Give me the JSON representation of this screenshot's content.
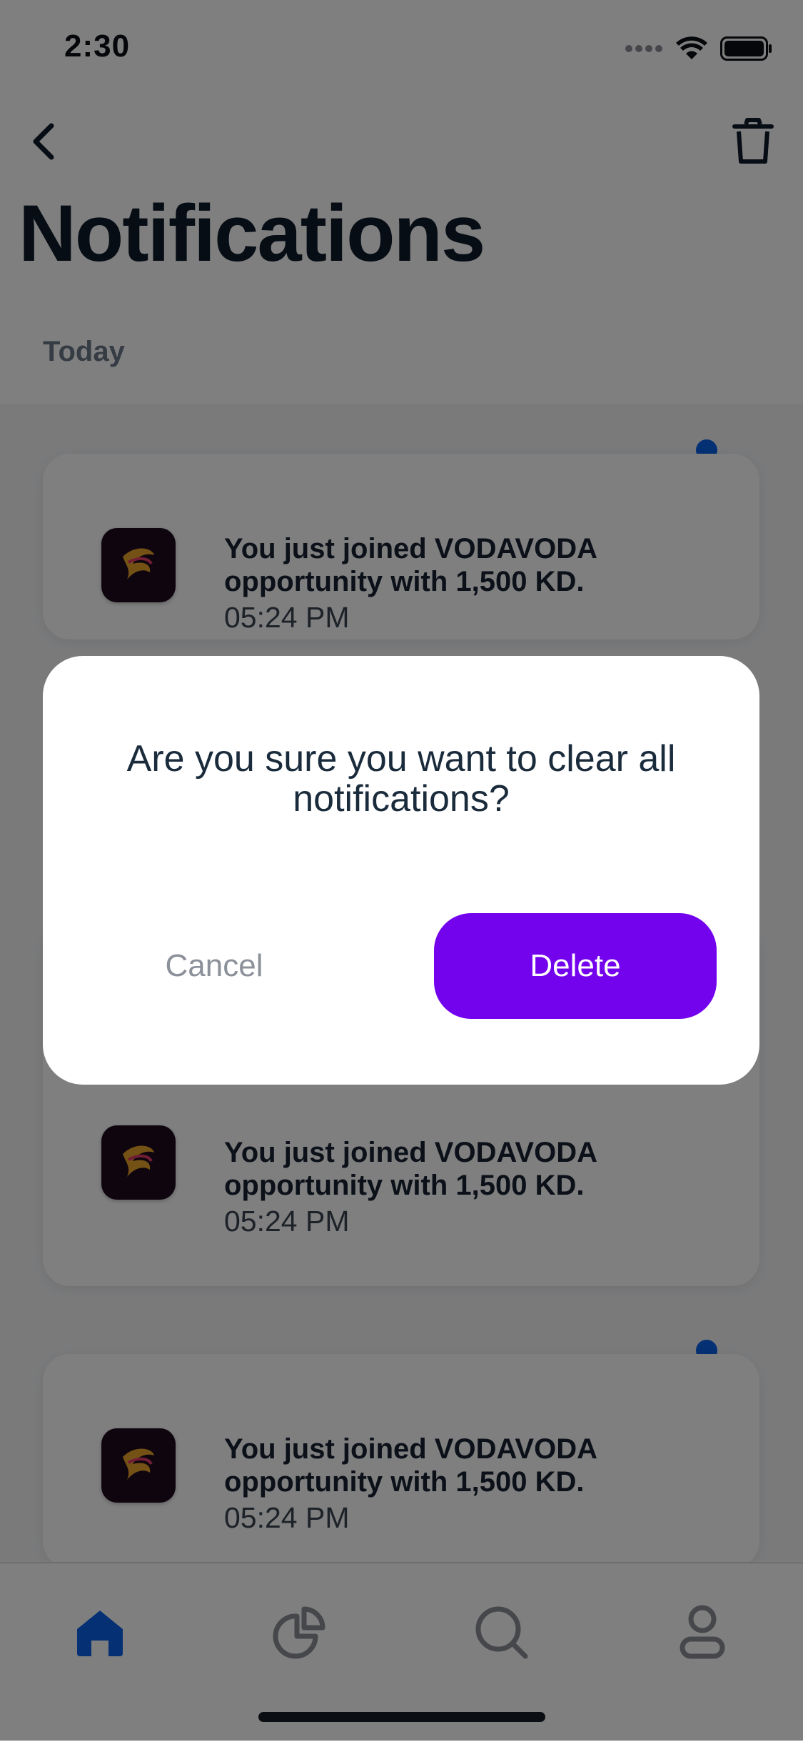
{
  "status_bar": {
    "time": "2:30"
  },
  "header": {
    "title": "Notifications"
  },
  "section": {
    "label": "Today"
  },
  "notifications": [
    {
      "message": "You just joined VODAVODA opportunity with 1,500 KD.",
      "time": "05:24 PM",
      "unread": true
    },
    {
      "message": "You just joined VODAVODA opportunity with 1,500 KD.",
      "time": "05:24 PM",
      "unread": false
    },
    {
      "message": "You just joined VODAVODA opportunity with 1,500 KD.",
      "time": "05:24 PM",
      "unread": true
    }
  ],
  "dialog": {
    "message": "Are you sure you want to clear all notifications?",
    "cancel_label": "Cancel",
    "delete_label": "Delete"
  },
  "bottom_nav": {
    "items": [
      {
        "icon": "home-icon",
        "active": true
      },
      {
        "icon": "portfolio-icon",
        "active": false
      },
      {
        "icon": "search-icon",
        "active": false
      },
      {
        "icon": "profile-icon",
        "active": false
      }
    ]
  },
  "colors": {
    "accent": "#7403ed",
    "unread_dot": "#0a63e8",
    "active_nav": "#0a63e8"
  }
}
